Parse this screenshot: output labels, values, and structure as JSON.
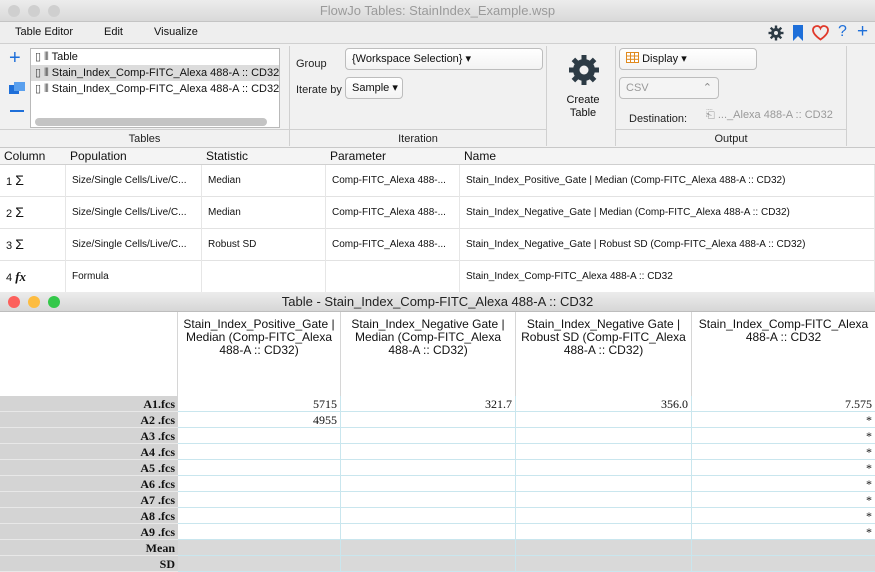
{
  "window": {
    "title": "FlowJo Tables: StainIndex_Example.wsp"
  },
  "menu": {
    "items": [
      "Table Editor",
      "Edit",
      "Visualize"
    ]
  },
  "toolbar_right": {
    "icons": [
      "gear-icon",
      "bookmark-icon",
      "heart-icon",
      "help-icon",
      "plus-icon"
    ],
    "help": "?",
    "plus": "+"
  },
  "tables": {
    "rows": [
      "Table",
      "Stain_Index_Comp-FITC_Alexa 488-A :: CD32",
      "Stain_Index_Comp-FITC_Alexa 488-A :: CD32"
    ],
    "section_label": "Tables"
  },
  "iteration": {
    "group_label": "Group",
    "group_value": "{Workspace Selection}",
    "iterate_label": "Iterate by",
    "iterate_value": "Sample",
    "section_label": "Iteration"
  },
  "create": {
    "label": "Create\nTable"
  },
  "output": {
    "display_label": "Display",
    "format_value": "CSV",
    "destination_label": "Destination:",
    "destination_value": "..._Alexa 488-A :: CD32",
    "section_label": "Output"
  },
  "grid": {
    "headers": [
      "Column",
      "Population",
      "Statistic",
      "Parameter",
      "Name"
    ],
    "rows": [
      {
        "num": "1",
        "icon": "Σ",
        "population": "Size/Single Cells/Live/C...",
        "statistic": "Median",
        "parameter": "Comp-FITC_Alexa 488-...",
        "name": "Stain_Index_Positive_Gate | Median (Comp-FITC_Alexa 488-A :: CD32)"
      },
      {
        "num": "2",
        "icon": "Σ",
        "population": "Size/Single Cells/Live/C...",
        "statistic": "Median",
        "parameter": "Comp-FITC_Alexa 488-...",
        "name": "Stain_Index_Negative_Gate | Median (Comp-FITC_Alexa 488-A :: CD32)"
      },
      {
        "num": "3",
        "icon": "Σ",
        "population": "Size/Single Cells/Live/C...",
        "statistic": "Robust SD",
        "parameter": "Comp-FITC_Alexa 488-...",
        "name": "Stain_Index_Negative_Gate | Robust SD (Comp-FITC_Alexa 488-A :: CD32)"
      },
      {
        "num": "4",
        "icon": "fx",
        "population": "Formula",
        "statistic": "",
        "parameter": "",
        "name": "Stain_Index_Comp-FITC_Alexa 488-A :: CD32"
      }
    ]
  },
  "table_window": {
    "title": "Table - Stain_Index_Comp-FITC_Alexa 488-A :: CD32"
  },
  "data_table": {
    "columns": [
      "Stain_Index_Positive_Gate | Median (Comp-FITC_Alexa 488-A :: CD32)",
      "Stain_Index_Negative Gate | Median (Comp-FITC_Alexa 488-A :: CD32)",
      "Stain_Index_Negative Gate | Robust SD (Comp-FITC_Alexa 488-A :: CD32)",
      "Stain_Index_Comp-FITC_Alexa 488-A :: CD32"
    ],
    "rows": [
      {
        "label": "A1.fcs",
        "values": [
          "5715",
          "321.7",
          "356.0",
          "7.575"
        ]
      },
      {
        "label": "A2 .fcs",
        "values": [
          "4955",
          "",
          "",
          "*"
        ]
      },
      {
        "label": "A3 .fcs",
        "values": [
          "",
          "",
          "",
          "*"
        ]
      },
      {
        "label": "A4 .fcs",
        "values": [
          "",
          "",
          "",
          "*"
        ]
      },
      {
        "label": "A5 .fcs",
        "values": [
          "",
          "",
          "",
          "*"
        ]
      },
      {
        "label": "A6 .fcs",
        "values": [
          "",
          "",
          "",
          "*"
        ]
      },
      {
        "label": "A7 .fcs",
        "values": [
          "",
          "",
          "",
          "*"
        ]
      },
      {
        "label": "A8 .fcs",
        "values": [
          "",
          "",
          "",
          "*"
        ]
      },
      {
        "label": "A9 .fcs",
        "values": [
          "",
          "",
          "",
          "*"
        ]
      },
      {
        "label": "Mean",
        "values": [
          "",
          "",
          "",
          ""
        ]
      },
      {
        "label": "SD",
        "values": [
          "",
          "",
          "",
          ""
        ]
      }
    ]
  },
  "colors": {
    "close": "#fc605c",
    "minimize": "#fdbc40",
    "zoom": "#34c84a",
    "inactive_dot": "#d0d0d0",
    "accent": "#1e6fd9",
    "heart": "#e0392b",
    "gear": "#2d3b45"
  }
}
